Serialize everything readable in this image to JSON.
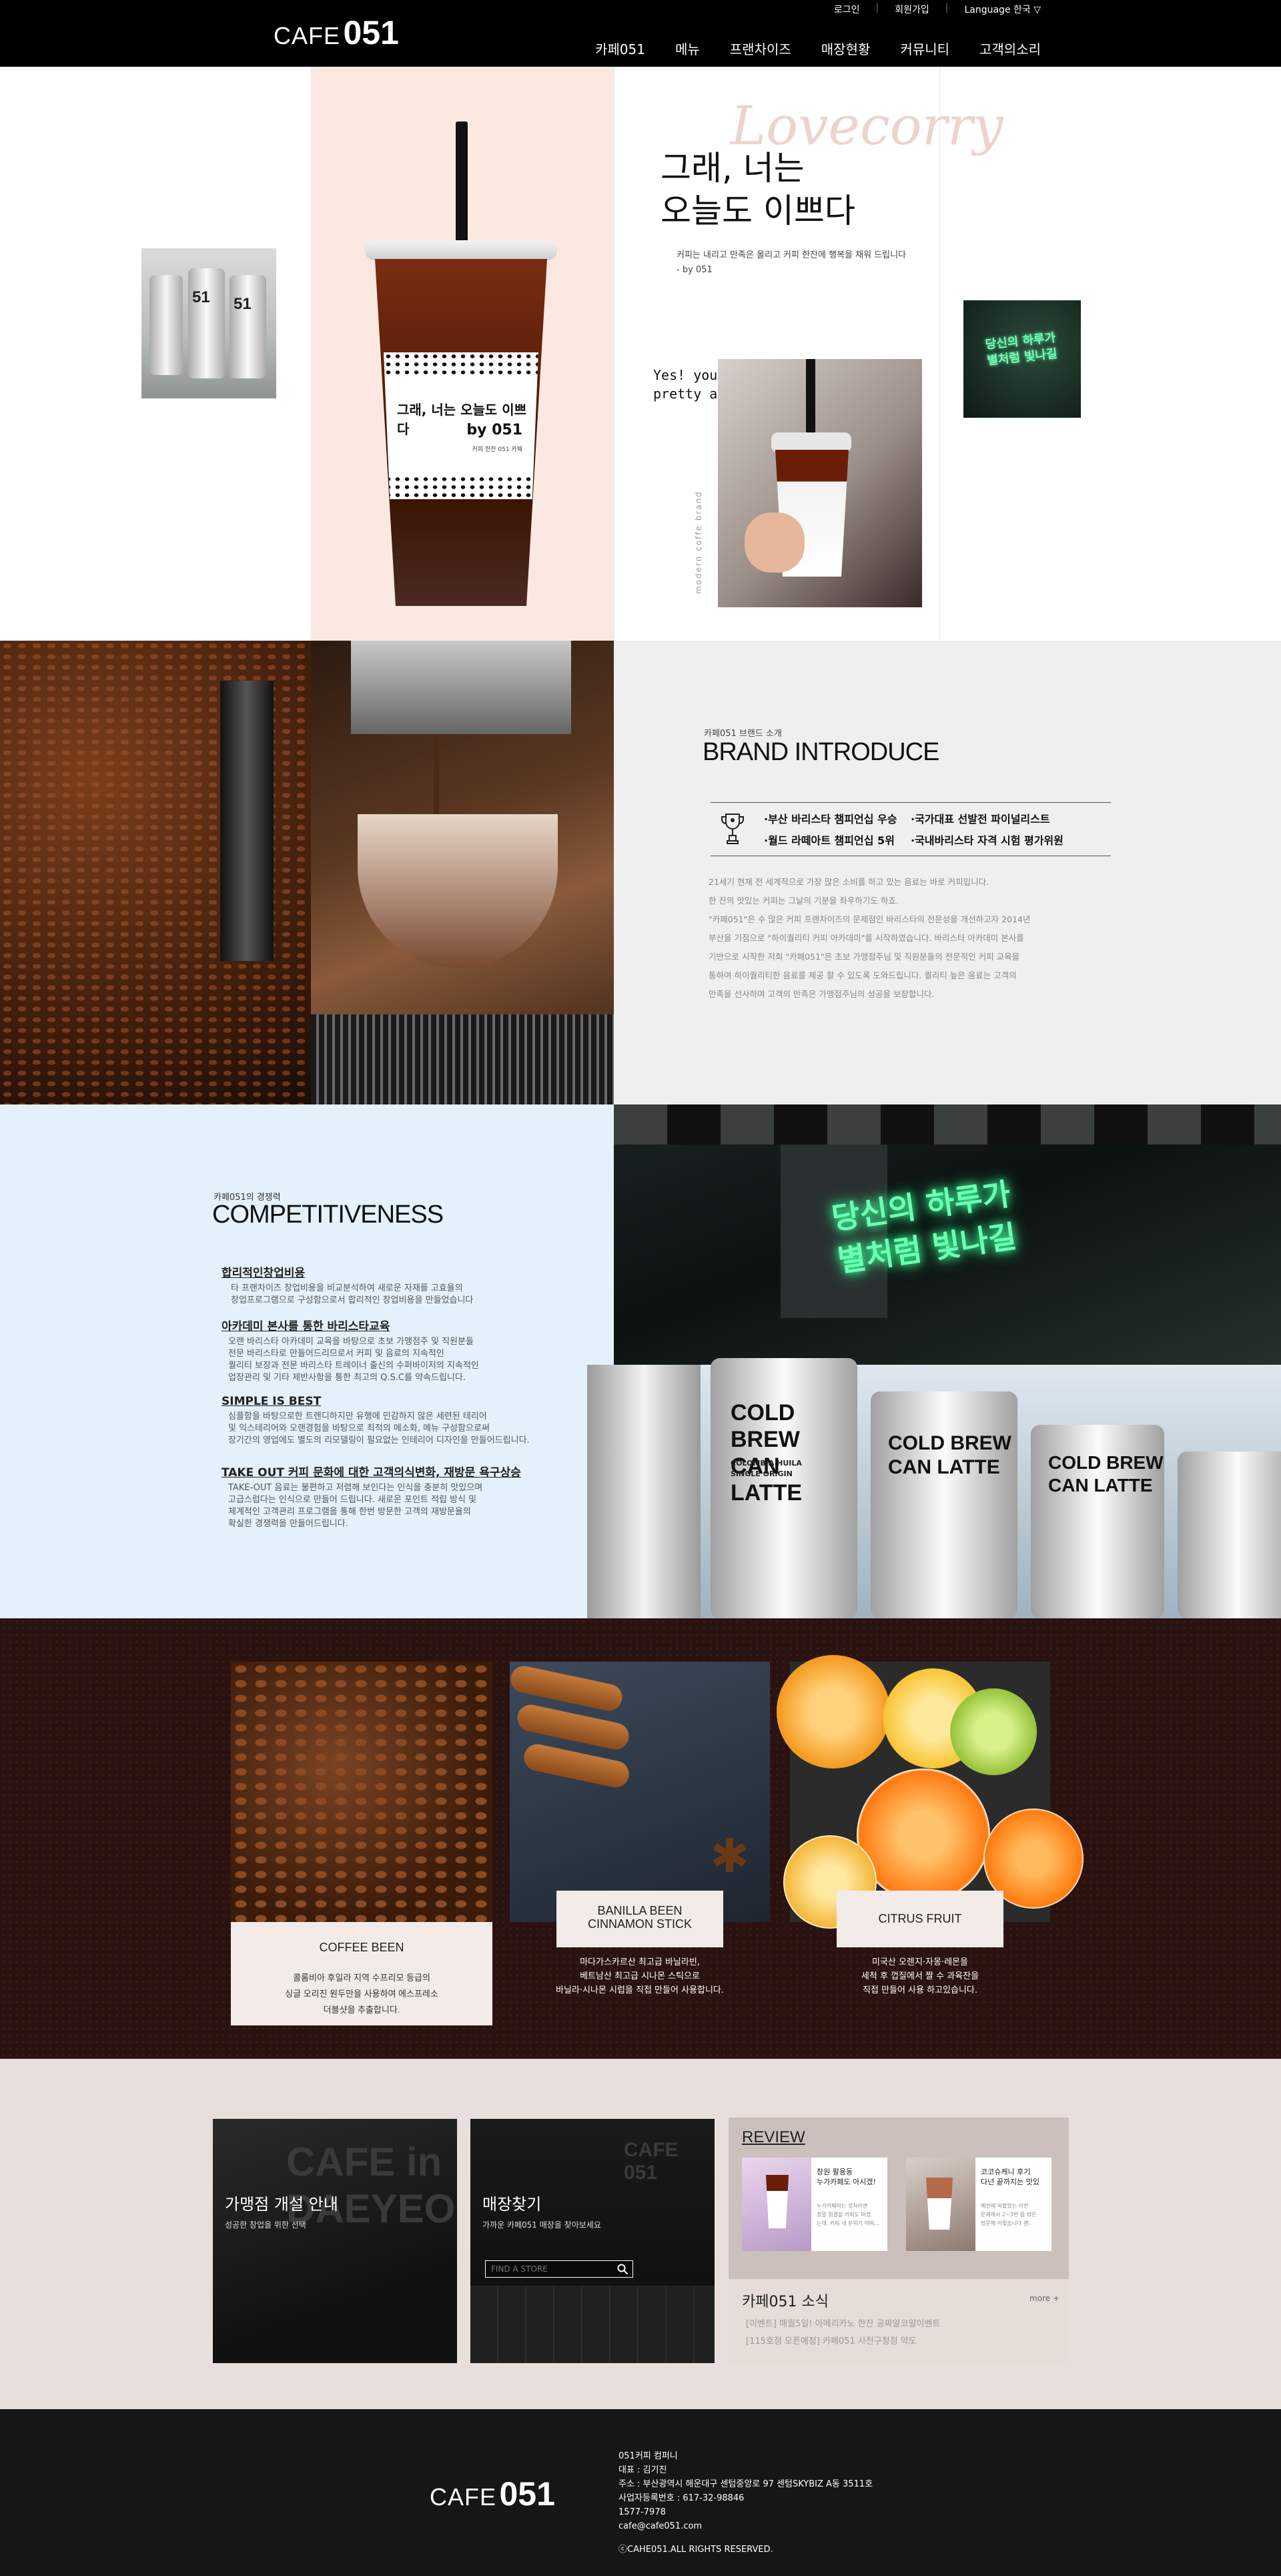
{
  "header": {
    "logo_small": "CAFE",
    "logo_big": "051",
    "top_links": [
      "로그인",
      "회원가입",
      "Language 한국 ▽"
    ],
    "nav": [
      "카페051",
      "메뉴",
      "프랜차이즈",
      "매장현황",
      "커뮤니티",
      "고객의소리"
    ]
  },
  "hero": {
    "headline_line1": "그래, 너는",
    "headline_line2": "오늘도 이쁘다",
    "script_deco": "Lovecorry",
    "sub_line1": "커피는 내리고 만족은 올리고 커피 한잔에 행복을 채워 드립니다",
    "sub_line2": "- by 051",
    "cup_sleeve_line1": "그래, 너는 오늘도 이쁘다",
    "cup_sleeve_line2": "by 051",
    "cup_sleeve_small": "커피 한잔 051 카페",
    "yes_line1": "Yes! you are",
    "yes_line2": "pretty again today",
    "vertical_text": "modern coffe brand",
    "neon_small_line1": "당신의 하루가",
    "neon_small_line2": "별처럼 빛나길"
  },
  "brand": {
    "sub": "카페051 브랜드 소개",
    "title": "BRAND INTRODUCE",
    "awards": [
      "·부산 바리스타 챔피언십 우승",
      "·국가대표 선발전 파이널리스트",
      "·월드 라떼아트 챔피언십 5위",
      "·국내바리스타 자격 시험 평가위원"
    ],
    "paragraph": [
      "21세기 현재 전 세계적으로 가장 많은 소비를 하고 있는 음료는 바로 커피입니다.",
      "한 잔의 맛있는 커피는 그날의 기분을 좌우하기도 하죠.",
      "\"카페051\"은 수 많은 커피 프랜차이즈의 문제점인 바리스타의 전문성을 개선하고자 2014년",
      "부산을 기점으로 \"하이퀄리티 커피 아카데미\"를 시작하였습니다. 바리스타 아카데미 본사를",
      "기반으로 시작한 저희 \"카페051\"은 초보 가맹점주님 및 직원분들의 전문적인 커피 교육을",
      "통하여 하이퀄리티한 음료를 제공 할 수 있도록 도와드립니다. 퀄리티 높은 음료는 고객의",
      "만족을 선사하며 고객의 만족은 가맹점주님의 성공을 보장합니다."
    ]
  },
  "competitiveness": {
    "sub": "카페051의 경쟁력",
    "title": "COMPETITIVENESS",
    "items": [
      {
        "title": "합리적인창업비용",
        "desc": [
          "타 프랜차이즈 창업비용을 비교분석하여 새로운 자재를 고효율의",
          "창업프로그램으로 구성함으로서 합리적인 창업비용을 만들었습니다"
        ]
      },
      {
        "title": "아카데미 본사를 통한 바리스타교육",
        "desc": [
          "오랜 바리스타 아카데미 교육을 바탕으로 초보 가맹점주 및 직원분들",
          "전문 바리스타로 만들어드리므로서 커피 및 음료의 지속적인",
          "퀄리티 보장과 전문 바리스타 트레이너 출신의 수퍼바이저의 지속적인",
          "업장관리 및 기타 제반사항을 통한 최고의 Q.S.C를 약속드립니다."
        ]
      },
      {
        "title": "SIMPLE IS BEST",
        "desc": [
          "심플함을 바탕으로한 트렌디하지만 유행에 민감하지 않은 세련된 테리어",
          "및 익스테리어와 오랜경험을 바탕으로 최적의 메소화, 메뉴 구성함으로써",
          "장기간의 영업에도 별도의 리모델링이 필요없는 인테리어 디자인을 만들어드립니다."
        ]
      },
      {
        "title": "TAKE OUT 커피 문화에 대한 고객의식변화, 재방문 욕구상승",
        "desc": [
          "TAKE-OUT 음료는 불편하고 저렴해 보인다는 인식을 충분히 맛있으며",
          "고급스럽다는 인식으로 만들어 드립니다. 새로운 포인트 적립 방식 및",
          "체계적인 고객관리 프로그램을 통해 한번 방문한 고객의 재방문율의",
          "확실한 경쟁력을 만들어드립니다."
        ]
      }
    ],
    "neon_line1": "당신의 하루가",
    "neon_line2": "별처럼 빛나길",
    "can_line1": "COLD BREW",
    "can_line2": "CAN LATTE",
    "can_small1": "COLOMBIA HUILA",
    "can_small2": "SINGLE ORIGIN"
  },
  "ingredients": [
    {
      "title": "COFFEE BEEN",
      "desc": [
        "콜롬비아 후일라 지역 수프리모 등급의",
        "싱글 오리진 원두만을 사용하여 에스프레소",
        "더블샷을 추출합니다."
      ]
    },
    {
      "title": "BANILLA BEEN CINNAMON STICK",
      "title_line1": "BANILLA BEEN",
      "title_line2": "CINNAMON STICK",
      "desc": [
        "마다가스카르산 최고급 바닐라빈,",
        "베트남산 최고급 시나몬 스틱으로",
        "바닐라·시나몬 시럽을 직접 만들어 사용합니다."
      ]
    },
    {
      "title": "CITRUS FRUIT",
      "desc": [
        "미국산 오렌지·자몽·레몬을",
        "세척 후 껍질에서 짤 수 과육잔을",
        "직접 만들어 사용 하고있습니다."
      ]
    }
  ],
  "bottom": {
    "franchise_title": "가맹점 개설 안내",
    "franchise_sub": "성공한 창업을 위한 선택",
    "store_title": "매장찾기",
    "store_sub": "가까운 카페051 매장을 찾아보세요",
    "store_search_placeholder": "FIND A STORE",
    "store_bg_text": "CAFE 051",
    "franchise_bg_text": "CAFE in DAEYEON",
    "review_title": "REVIEW",
    "reviews": [
      {
        "headline": [
          "창원 팔용동",
          "누가카페도 아시겠!"
        ],
        "body": [
          "누가카페하는 것처라면",
          "정말 점결을 커피도 마셨",
          "는데, 커피 내 분위기 어떠..."
        ]
      },
      {
        "headline": [
          "코코슈케니 후기",
          "다넌 끝까지는 맛있"
        ],
        "body": [
          "예전에 와봤었는 이번",
          "문제에서 2~3번 쯤 밖은",
          "방문해 이렇습니다 괜.."
        ]
      }
    ],
    "news_title": "카페051 소식",
    "news_more": "more +",
    "news_items": [
      "[이벤트] 매월5일! 아메리카노 한잔 공짜알코알이벤트",
      "[115호점 오픈예정] 카페051 사천구청점 약도"
    ]
  },
  "footer": {
    "logo_small": "CAFE",
    "logo_big": "051",
    "lines": [
      "051커피 컴퍼니",
      "대표 : 김기진",
      "주소 : 부산광역시 해운대구 센텀중앙로 97 센텀SKYBIZ  A동 3511호",
      "사업자등록번호 : 617-32-98846",
      "1577-7978",
      "cafe@cafe051.com"
    ],
    "copyright": "ⓒCAHE051.ALL RIGHTS RESERVED."
  },
  "colors": {
    "header_bg": "#000000",
    "hero_pink": "#fbe9e1",
    "brand_bg": "#efefef",
    "comp_bg": "#e4f1fb",
    "ingredients_bg": "#2a1210",
    "bottom_bg": "#e8dfdc",
    "footer_bg": "#161616",
    "neon": "#6dffb3"
  }
}
